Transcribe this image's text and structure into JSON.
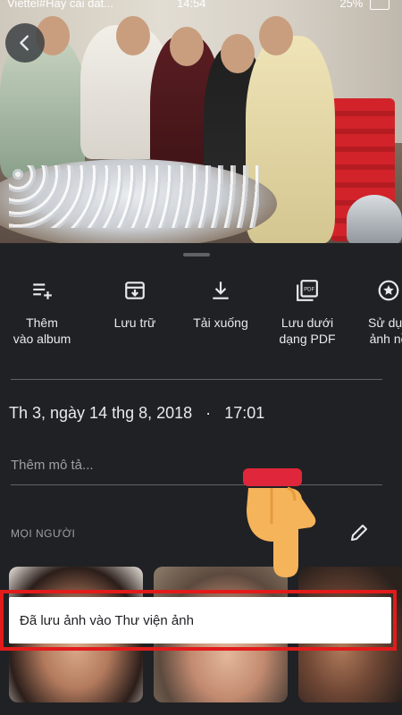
{
  "status_bar": {
    "carrier": "Viettel#Hay cai dat...",
    "time": "14:54",
    "battery": "25%"
  },
  "actions": [
    {
      "label_line1": "Thêm",
      "label_line2": "vào album",
      "icon": "playlist-add-icon"
    },
    {
      "label_line1": "Lưu trữ",
      "label_line2": "",
      "icon": "archive-icon"
    },
    {
      "label_line1": "Tải xuống",
      "label_line2": "",
      "icon": "download-icon"
    },
    {
      "label_line1": "Lưu dưới",
      "label_line2": "dạng PDF",
      "icon": "pdf-icon"
    },
    {
      "label_line1": "Sử dụn",
      "label_line2": "ảnh nề",
      "icon": "star-icon"
    }
  ],
  "details": {
    "date": "Th 3, ngày 14 thg 8, 2018",
    "separator": "·",
    "time": "17:01",
    "description_placeholder": "Thêm mô tả..."
  },
  "people": {
    "label": "MỌI NGƯỜI"
  },
  "toast": {
    "message": "Đã lưu ảnh vào Thư viện ảnh"
  },
  "colors": {
    "background": "#202124",
    "highlight": "#e21b1b",
    "text_secondary": "#9aa0a6"
  }
}
